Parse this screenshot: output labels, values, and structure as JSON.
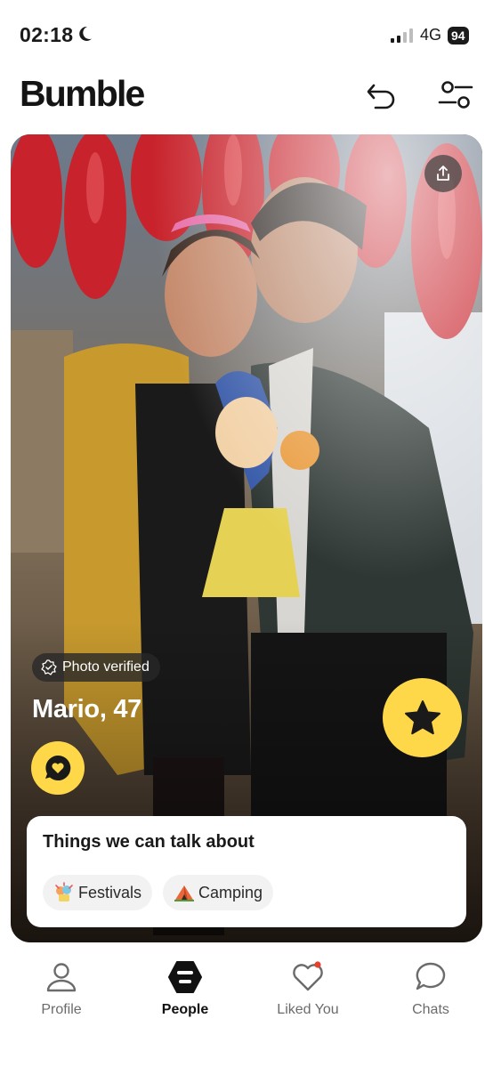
{
  "status_bar": {
    "time": "02:18",
    "network": "4G",
    "battery": "94",
    "icons": [
      "moon-icon",
      "signal-icon"
    ]
  },
  "header": {
    "logo": "Bumble",
    "icons": [
      "undo-icon",
      "filter-icon"
    ]
  },
  "profile_card": {
    "photo_description_icon": "profile-photo",
    "verified_label": "Photo verified",
    "name_age": "Mario, 47",
    "icons": [
      "share-icon",
      "compliment-icon",
      "star-icon",
      "verified-check-icon"
    ],
    "talk_about": {
      "title": "Things we can talk about",
      "chips": [
        {
          "label": "Festivals",
          "icon": "festival-icon"
        },
        {
          "label": "Camping",
          "icon": "tent-icon"
        }
      ]
    }
  },
  "bottom_nav": {
    "items": [
      {
        "label": "Profile",
        "icon": "profile-icon",
        "active": false
      },
      {
        "label": "People",
        "icon": "people-icon",
        "active": true
      },
      {
        "label": "Liked You",
        "icon": "heart-icon",
        "active": false,
        "notification_dot": true
      },
      {
        "label": "Chats",
        "icon": "chat-bubble-icon",
        "active": false
      }
    ]
  },
  "colors": {
    "accent_yellow": "#ffd84a",
    "text_dark": "#1a1a1a",
    "notification_red": "#e8402f"
  }
}
